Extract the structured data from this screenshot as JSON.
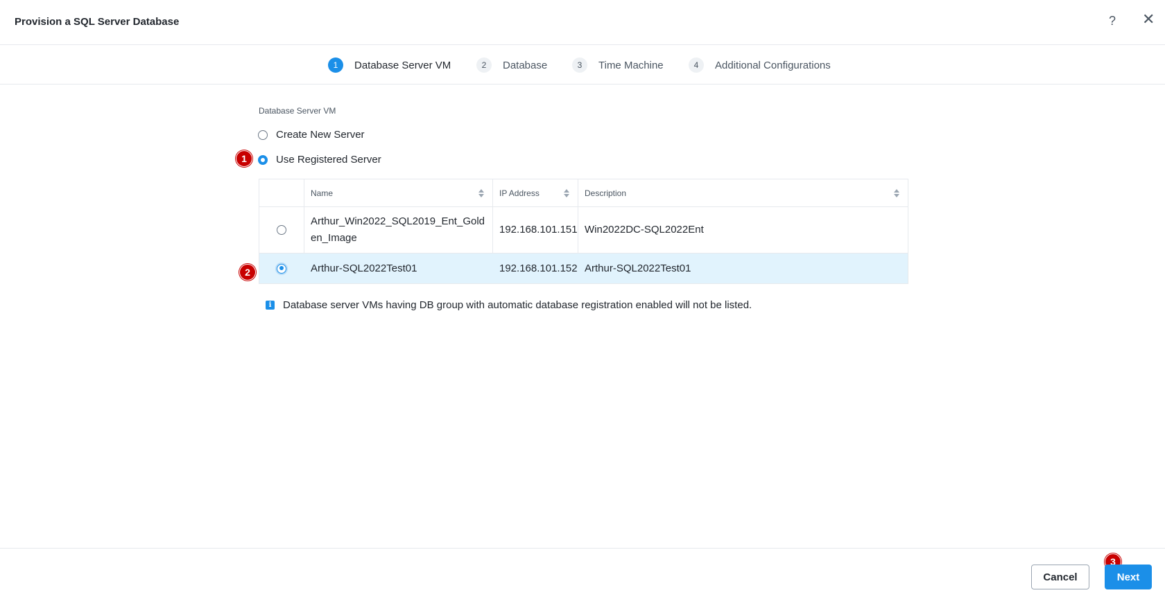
{
  "dialog": {
    "title": "Provision a SQL Server Database",
    "help_label": "?",
    "close_label": "✕"
  },
  "steps": [
    {
      "number": "1",
      "label": "Database Server VM",
      "active": true
    },
    {
      "number": "2",
      "label": "Database",
      "active": false
    },
    {
      "number": "3",
      "label": "Time Machine",
      "active": false
    },
    {
      "number": "4",
      "label": "Additional Configurations",
      "active": false
    }
  ],
  "server_vm": {
    "section_label": "Database Server VM",
    "options": [
      {
        "label": "Create New Server",
        "selected": false
      },
      {
        "label": "Use Registered Server",
        "selected": true
      }
    ]
  },
  "table": {
    "columns": [
      "Name",
      "IP Address",
      "Description"
    ],
    "rows": [
      {
        "name_line1": "Arthur_Win2022_SQL2019_Ent_Gold",
        "name_line2": "en_Image",
        "ip": "192.168.101.151",
        "description": "Win2022DC-SQL2022Ent",
        "selected": false
      },
      {
        "name_line1": "Arthur-SQL2022Test01",
        "ip": "192.168.101.152",
        "description": "Arthur-SQL2022Test01",
        "selected": true
      }
    ]
  },
  "info": {
    "icon": "info-icon",
    "text": "Database server VMs having DB group with automatic database registration enabled will not be listed."
  },
  "annotations": [
    "1",
    "2",
    "3"
  ],
  "footer": {
    "cancel_label": "Cancel",
    "next_label": "Next"
  },
  "colors": {
    "accent": "#1b8fe8",
    "annotation_red": "#c80000",
    "selected_row": "#e1f3fd"
  }
}
